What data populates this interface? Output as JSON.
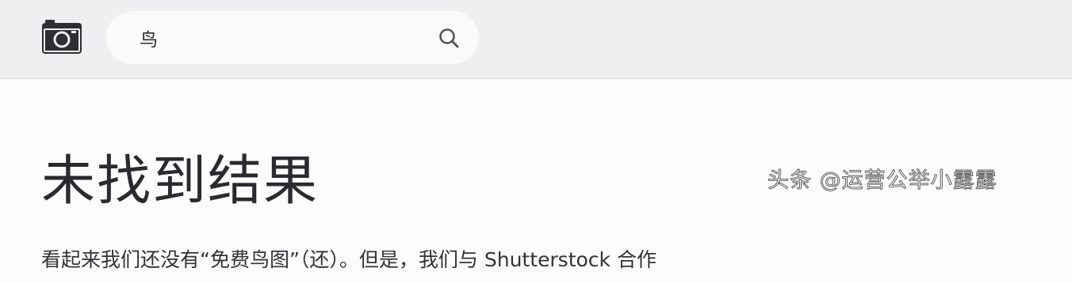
{
  "header": {
    "search": {
      "value": "鸟"
    }
  },
  "main": {
    "title": "未找到结果",
    "description": "看起来我们还没有“免费鸟图”（还）。但是，我们与 Shutterstock 合作"
  },
  "watermark": {
    "text": "头条 @运营公举小露露"
  },
  "icons": [
    "camera-icon",
    "search-icon"
  ]
}
